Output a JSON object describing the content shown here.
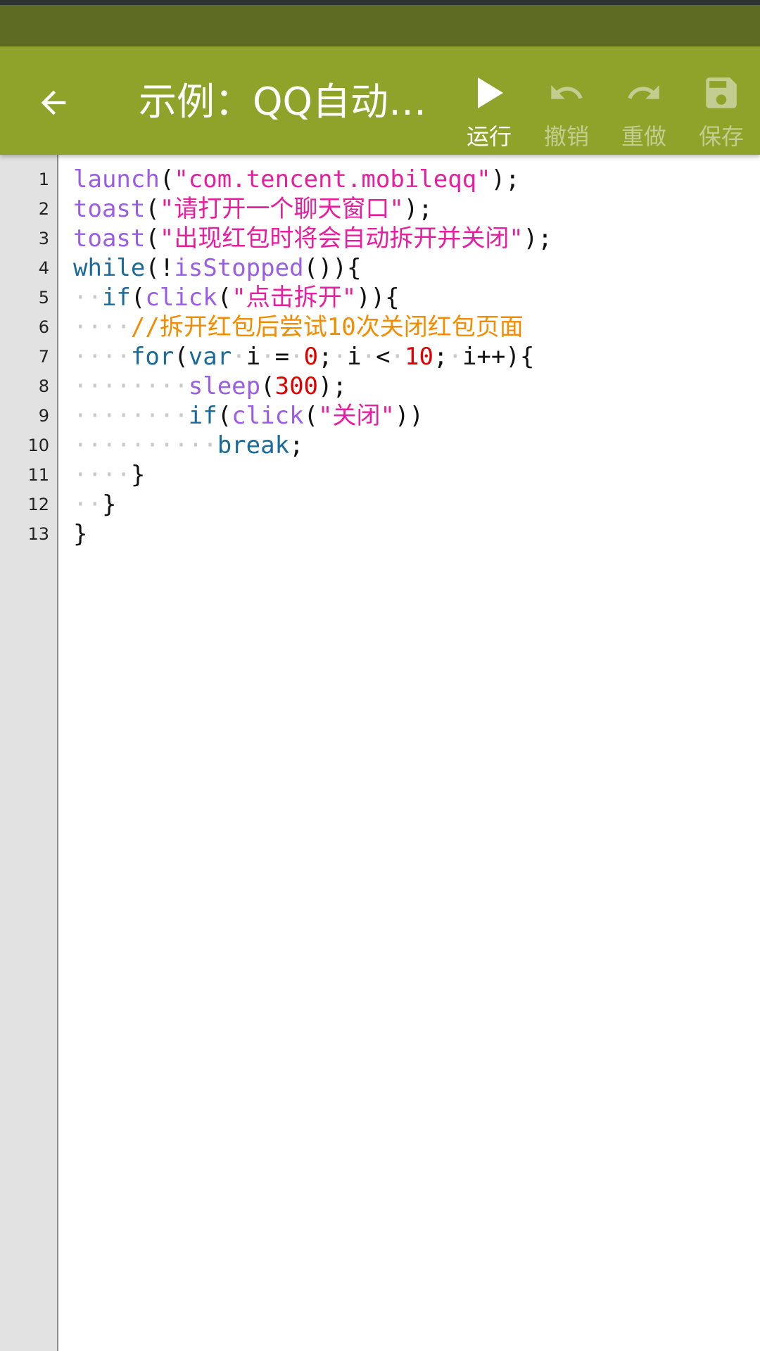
{
  "toolbar": {
    "title": "示例：QQ自动…",
    "actions": [
      {
        "name": "run",
        "label": "运行",
        "icon": "play-icon",
        "enabled": true
      },
      {
        "name": "undo",
        "label": "撤销",
        "icon": "undo-icon",
        "enabled": false
      },
      {
        "name": "redo",
        "label": "重做",
        "icon": "redo-icon",
        "enabled": false
      },
      {
        "name": "save",
        "label": "保存",
        "icon": "save-icon",
        "enabled": false
      }
    ]
  },
  "colors": {
    "toolbar_bg": "#8fa32b",
    "statusbar_bg": "#5e6b22",
    "function": "#9b5de5",
    "keyword": "#1a6a9a",
    "string": "#e81ea0",
    "number": "#e00000",
    "comment": "#f28c00"
  },
  "editor": {
    "line_numbers": [
      "1",
      "2",
      "3",
      "4",
      "5",
      "6",
      "7",
      "8",
      "9",
      "10",
      "11",
      "12",
      "13"
    ],
    "lines": [
      [
        {
          "t": "fn",
          "v": "launch"
        },
        {
          "t": "plain",
          "v": "("
        },
        {
          "t": "str",
          "v": "\"com.tencent.mobileqq\""
        },
        {
          "t": "plain",
          "v": ");"
        }
      ],
      [
        {
          "t": "fn",
          "v": "toast"
        },
        {
          "t": "plain",
          "v": "("
        },
        {
          "t": "str",
          "v": "\"请打开一个聊天窗口\""
        },
        {
          "t": "plain",
          "v": ");"
        }
      ],
      [
        {
          "t": "fn",
          "v": "toast"
        },
        {
          "t": "plain",
          "v": "("
        },
        {
          "t": "str",
          "v": "\"出现红包时将会自动拆开并关闭\""
        },
        {
          "t": "plain",
          "v": ");"
        }
      ],
      [
        {
          "t": "kw",
          "v": "while"
        },
        {
          "t": "plain",
          "v": "(!"
        },
        {
          "t": "fn",
          "v": "isStopped"
        },
        {
          "t": "plain",
          "v": "()){"
        }
      ],
      [
        {
          "t": "ws",
          "v": "··"
        },
        {
          "t": "kw",
          "v": "if"
        },
        {
          "t": "plain",
          "v": "("
        },
        {
          "t": "fn",
          "v": "click"
        },
        {
          "t": "plain",
          "v": "("
        },
        {
          "t": "str",
          "v": "\"点击拆开\""
        },
        {
          "t": "plain",
          "v": ")){"
        }
      ],
      [
        {
          "t": "ws",
          "v": "····"
        },
        {
          "t": "cmt",
          "v": "//拆开红包后尝试10次关闭红包页面"
        }
      ],
      [
        {
          "t": "ws",
          "v": "····"
        },
        {
          "t": "kw",
          "v": "for"
        },
        {
          "t": "plain",
          "v": "("
        },
        {
          "t": "kw",
          "v": "var"
        },
        {
          "t": "ws",
          "v": "·"
        },
        {
          "t": "plain",
          "v": "i"
        },
        {
          "t": "ws",
          "v": "·"
        },
        {
          "t": "plain",
          "v": "="
        },
        {
          "t": "ws",
          "v": "·"
        },
        {
          "t": "num",
          "v": "0"
        },
        {
          "t": "plain",
          "v": ";"
        },
        {
          "t": "ws",
          "v": "·"
        },
        {
          "t": "plain",
          "v": "i"
        },
        {
          "t": "ws",
          "v": "·"
        },
        {
          "t": "plain",
          "v": "<"
        },
        {
          "t": "ws",
          "v": "·"
        },
        {
          "t": "num",
          "v": "10"
        },
        {
          "t": "plain",
          "v": ";"
        },
        {
          "t": "ws",
          "v": "·"
        },
        {
          "t": "plain",
          "v": "i++){"
        }
      ],
      [
        {
          "t": "ws",
          "v": "········"
        },
        {
          "t": "fn",
          "v": "sleep"
        },
        {
          "t": "plain",
          "v": "("
        },
        {
          "t": "num",
          "v": "300"
        },
        {
          "t": "plain",
          "v": ");"
        }
      ],
      [
        {
          "t": "ws",
          "v": "········"
        },
        {
          "t": "kw",
          "v": "if"
        },
        {
          "t": "plain",
          "v": "("
        },
        {
          "t": "fn",
          "v": "click"
        },
        {
          "t": "plain",
          "v": "("
        },
        {
          "t": "str",
          "v": "\"关闭\""
        },
        {
          "t": "plain",
          "v": "))"
        }
      ],
      [
        {
          "t": "ws",
          "v": "··········"
        },
        {
          "t": "kw",
          "v": "break"
        },
        {
          "t": "plain",
          "v": ";"
        }
      ],
      [
        {
          "t": "ws",
          "v": "····"
        },
        {
          "t": "plain",
          "v": "}"
        }
      ],
      [
        {
          "t": "ws",
          "v": "··"
        },
        {
          "t": "plain",
          "v": "}"
        }
      ],
      [
        {
          "t": "plain",
          "v": "}"
        }
      ]
    ]
  }
}
